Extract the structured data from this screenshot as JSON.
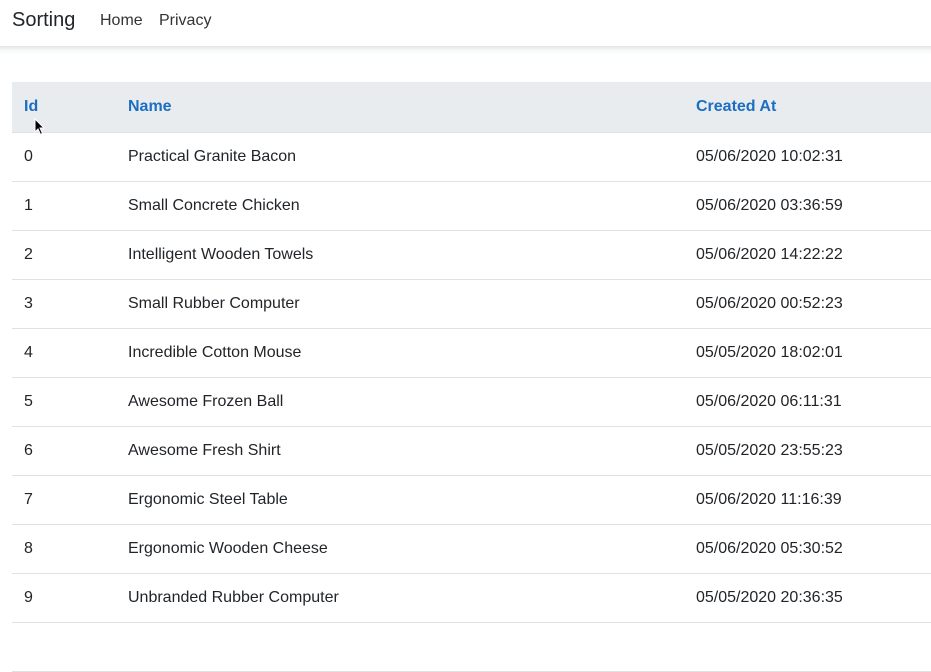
{
  "navbar": {
    "brand": "Sorting",
    "links": [
      "Home",
      "Privacy"
    ]
  },
  "table": {
    "headers": {
      "id": "Id",
      "name": "Name",
      "created_at": "Created At"
    },
    "rows": [
      {
        "id": "0",
        "name": "Practical Granite Bacon",
        "created_at": "05/06/2020 10:02:31"
      },
      {
        "id": "1",
        "name": "Small Concrete Chicken",
        "created_at": "05/06/2020 03:36:59"
      },
      {
        "id": "2",
        "name": "Intelligent Wooden Towels",
        "created_at": "05/06/2020 14:22:22"
      },
      {
        "id": "3",
        "name": "Small Rubber Computer",
        "created_at": "05/06/2020 00:52:23"
      },
      {
        "id": "4",
        "name": "Incredible Cotton Mouse",
        "created_at": "05/05/2020 18:02:01"
      },
      {
        "id": "5",
        "name": "Awesome Frozen Ball",
        "created_at": "05/06/2020 06:11:31"
      },
      {
        "id": "6",
        "name": "Awesome Fresh Shirt",
        "created_at": "05/05/2020 23:55:23"
      },
      {
        "id": "7",
        "name": "Ergonomic Steel Table",
        "created_at": "05/06/2020 11:16:39"
      },
      {
        "id": "8",
        "name": "Ergonomic Wooden Cheese",
        "created_at": "05/06/2020 05:30:52"
      },
      {
        "id": "9",
        "name": "Unbranded Rubber Computer",
        "created_at": "05/05/2020 20:36:35"
      }
    ]
  },
  "colors": {
    "link": "#1b6ec2",
    "header_bg": "#e9ecef",
    "border": "#dee2e6"
  },
  "cursor_icon": "mouse-pointer-icon"
}
